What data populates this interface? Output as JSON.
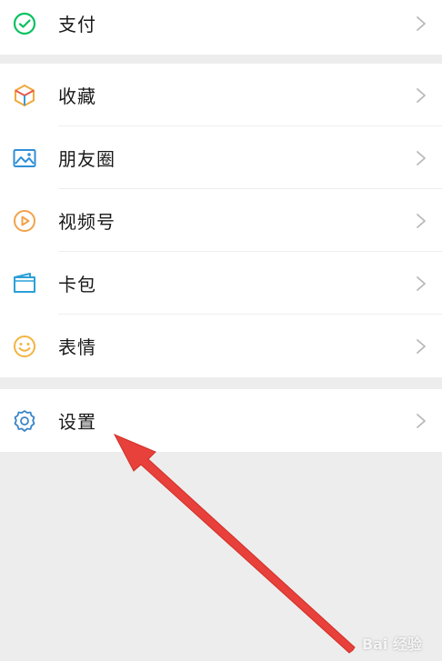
{
  "menu_top": {
    "items": [
      {
        "label": "支付",
        "icon": "pay-icon",
        "color": "#07c160"
      }
    ]
  },
  "menu_main": {
    "items": [
      {
        "label": "收藏",
        "icon": "favorites-cube-icon",
        "color": "#f0a93b"
      },
      {
        "label": "朋友圈",
        "icon": "moments-picture-icon",
        "color": "#2f8fd8"
      },
      {
        "label": "视频号",
        "icon": "channels-play-icon",
        "color": "#f2a24a"
      },
      {
        "label": "卡包",
        "icon": "card-wallet-icon",
        "color": "#2aa0d8"
      },
      {
        "label": "表情",
        "icon": "sticker-smile-icon",
        "color": "#f2b440"
      }
    ]
  },
  "menu_settings": {
    "items": [
      {
        "label": "设置",
        "icon": "gear-icon",
        "color": "#3a86c8"
      }
    ]
  },
  "annotation": {
    "arrow_color": "#e8403a"
  },
  "watermark": {
    "text": "Bai 经验"
  }
}
